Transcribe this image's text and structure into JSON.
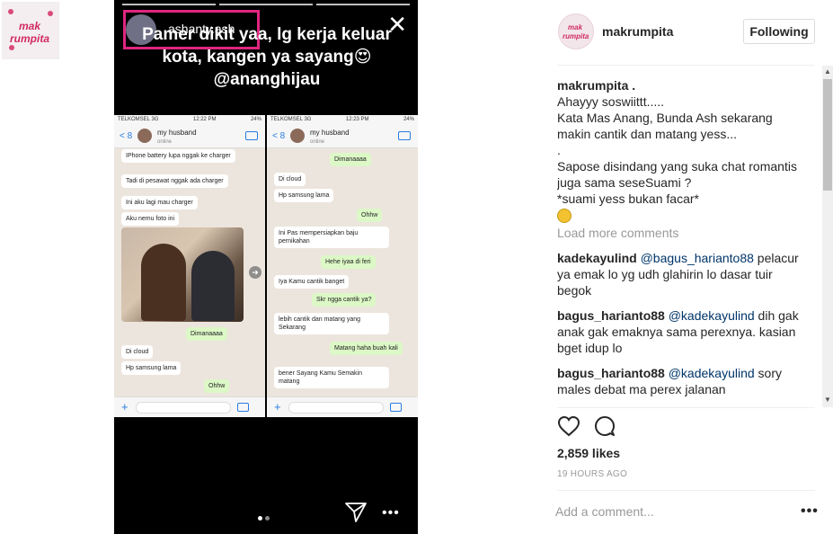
{
  "logo": {
    "text": "mak\nrumpita",
    "icon": "logo-icon"
  },
  "story": {
    "username": "ashanty.ash",
    "caption": "Pamer dikit yaa, lg kerja keluar kota, kangen ya sayang😍 @ananghijau",
    "close_icon": "close-icon",
    "chat_left": {
      "status_carrier": "TELKOMSEL 3G",
      "status_time": "12:22 PM",
      "status_battery": "24%",
      "back": "< 8",
      "contact": "my husband",
      "contact_sub": "online",
      "messages": [
        {
          "text": "IPhone battery lupa nggak ke charger",
          "dir": "in"
        },
        {
          "text": "Tadi di pesawat nggak ada charger",
          "dir": "in"
        },
        {
          "text": "Ini aku lagi mau charger",
          "dir": "in"
        },
        {
          "text": "Aku nemu foto ini",
          "dir": "in"
        },
        {
          "text": "Dimanaaaa",
          "dir": "out"
        },
        {
          "text": "Di cloud",
          "dir": "in"
        },
        {
          "text": "Hp samsung lama",
          "dir": "in"
        },
        {
          "text": "Ohhw",
          "dir": "out"
        }
      ]
    },
    "chat_right": {
      "status_carrier": "TELKOMSEL 3G",
      "status_time": "12:23 PM",
      "status_battery": "24%",
      "back": "< 8",
      "contact": "my husband",
      "contact_sub": "online",
      "messages": [
        {
          "text": "Dimanaaaa",
          "dir": "out"
        },
        {
          "text": "Di cloud",
          "dir": "in"
        },
        {
          "text": "Hp samsung lama",
          "dir": "in"
        },
        {
          "text": "Ohhw",
          "dir": "out"
        },
        {
          "text": "Ini Pas mempersiapkan baju pernikahan",
          "dir": "in"
        },
        {
          "text": "Hehe iyaa di feri",
          "dir": "out"
        },
        {
          "text": "Iya Kamu cantik banget",
          "dir": "in"
        },
        {
          "text": "Skr ngga cantik ya?",
          "dir": "out"
        },
        {
          "text": "lebih cantik dan matang yang Sekarang",
          "dir": "in"
        },
        {
          "text": "Matang haha buah kali",
          "dir": "out"
        },
        {
          "text": "bener Sayang Kamu Semakin matang",
          "dir": "in"
        }
      ]
    }
  },
  "header": {
    "username": "makrumpita",
    "follow_label": "Following"
  },
  "caption": {
    "username": "makrumpita .",
    "lines": [
      "Ahayyy soswiittt.....",
      "Kata Mas Anang, Bunda Ash sekarang",
      "makin cantik dan matang yess...",
      ".",
      "Sapose disindang yang suka chat romantis",
      "juga sama seseSuami ?",
      "*suami yess bukan facar*"
    ]
  },
  "load_more": "Load more comments",
  "comments": [
    {
      "user": "kadekayulind",
      "mention": "@bagus_harianto88",
      "text_first": " pelacur",
      "text_rest": [
        "ya emak lo yg udh glahirin lo dasar tuir",
        "begok"
      ]
    },
    {
      "user": "bagus_harianto88",
      "mention": "@kadekayulind",
      "text_first": " dih gak",
      "text_rest": [
        "anak gak emaknya sama perexnya. kasian",
        "bget idup lo"
      ]
    },
    {
      "user": "bagus_harianto88",
      "mention": "@kadekayulind",
      "text_first": " sory",
      "text_rest": [
        "males debat ma perex jalanan"
      ]
    }
  ],
  "likes": "2,859 likes",
  "time_ago": "19 HOURS AGO",
  "comment_placeholder": "Add a comment...",
  "more_label": "•••",
  "story_more_label": "•••"
}
